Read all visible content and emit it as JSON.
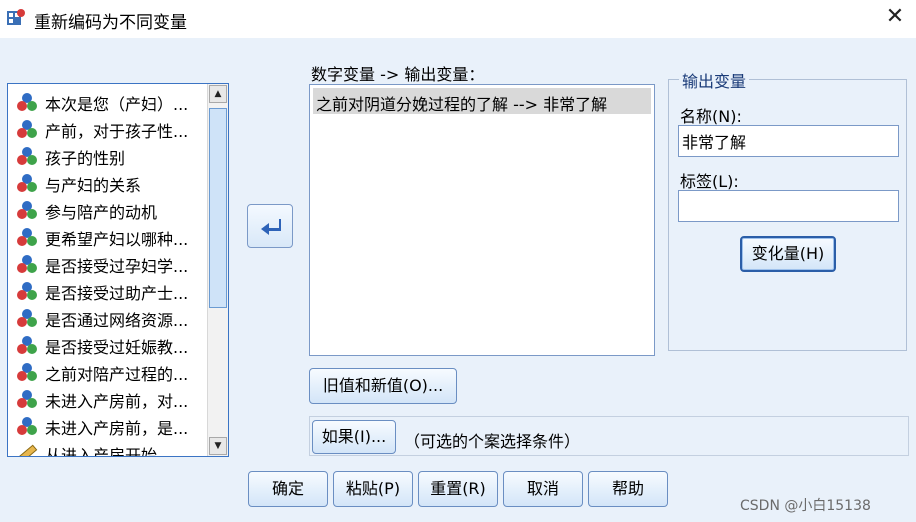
{
  "window": {
    "title": "重新编码为不同变量",
    "close_symbol": "✕"
  },
  "variable_list": {
    "items": [
      {
        "label": "本次是您（产妇）...",
        "type": "nominal"
      },
      {
        "label": "产前，对于孩子性...",
        "type": "nominal"
      },
      {
        "label": "孩子的性别",
        "type": "nominal"
      },
      {
        "label": "与产妇的关系",
        "type": "nominal"
      },
      {
        "label": "参与陪产的动机",
        "type": "nominal"
      },
      {
        "label": "更希望产妇以哪种...",
        "type": "nominal"
      },
      {
        "label": "是否接受过孕妇学...",
        "type": "nominal"
      },
      {
        "label": "是否接受过助产士...",
        "type": "nominal"
      },
      {
        "label": "是否通过网络资源...",
        "type": "nominal"
      },
      {
        "label": "是否接受过妊娠教...",
        "type": "nominal"
      },
      {
        "label": "之前对陪产过程的...",
        "type": "nominal"
      },
      {
        "label": "未进入产房前，对...",
        "type": "nominal"
      },
      {
        "label": "未进入产房前，是...",
        "type": "nominal"
      },
      {
        "label": "从进入产房开始，",
        "type": "scale"
      }
    ],
    "scroll_up_icon": "▲",
    "scroll_down_icon": "▼"
  },
  "mapping": {
    "label": "数字变量 -> 输出变量：",
    "rows": [
      "之前对阴道分娩过程的了解 --> 非常了解"
    ]
  },
  "output_variable": {
    "legend": "输出变量",
    "name_label": "名称(N):",
    "name_value": "非常了解",
    "label_label": "标签(L):",
    "label_value": "",
    "change_button": "变化量(H)"
  },
  "buttons": {
    "old_new_values": "旧值和新值(O)...",
    "if": "如果(I)...",
    "if_description": "（可选的个案选择条件）",
    "ok": "确定",
    "paste": "粘贴(P)",
    "reset": "重置(R)",
    "cancel": "取消",
    "help": "帮助"
  },
  "watermark": "CSDN @小白15138",
  "colors": {
    "dialog_bg": "#e9f1fa",
    "accent_border": "#3b74c4",
    "selection_bg": "#d9d9d9"
  }
}
